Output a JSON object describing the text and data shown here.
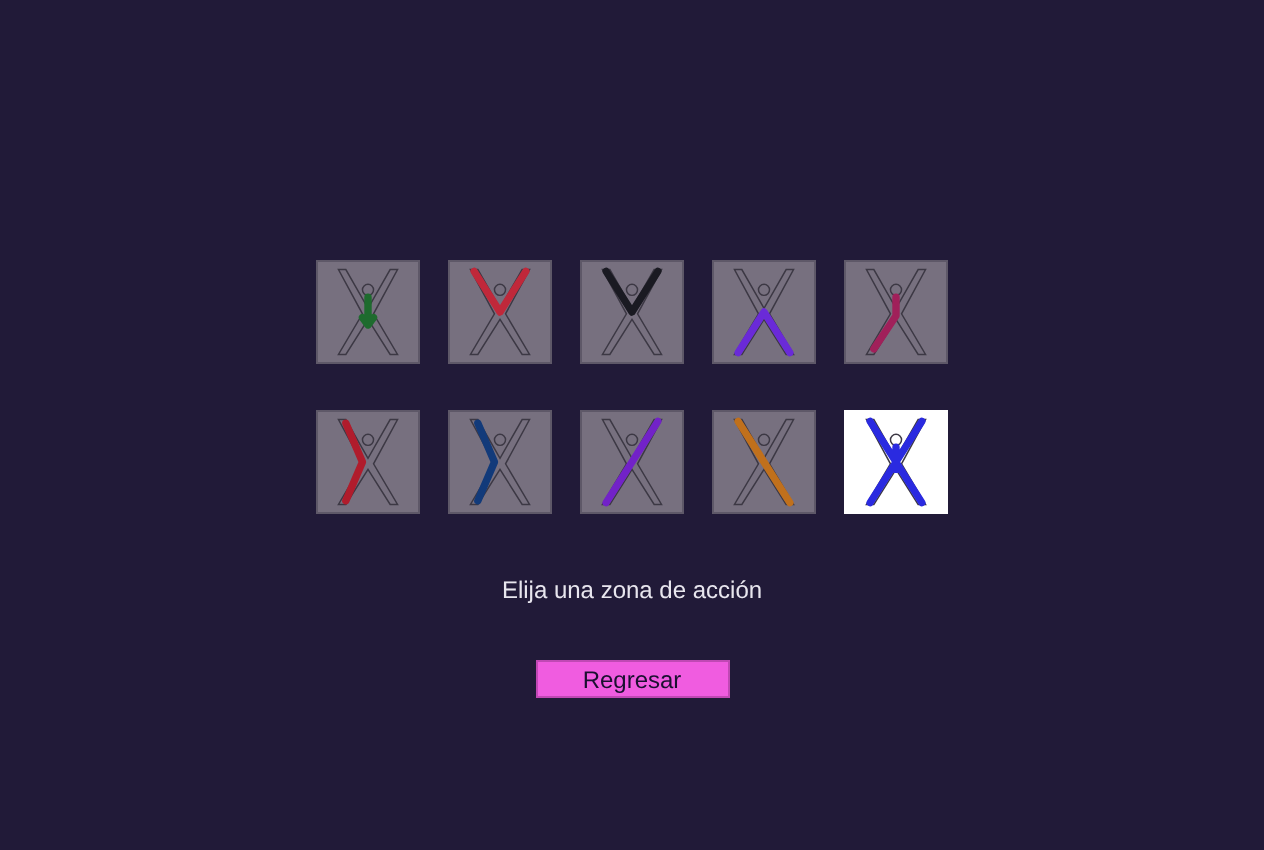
{
  "tiles": [
    {
      "kind": "torso",
      "color": "#1e6b2e",
      "selected": false
    },
    {
      "kind": "arms",
      "color": "#c0283a",
      "selected": false
    },
    {
      "kind": "arms",
      "color": "#1a1a22",
      "selected": false
    },
    {
      "kind": "legs",
      "color": "#6a2ad8",
      "selected": false
    },
    {
      "kind": "torso-leg",
      "color": "#a0205a",
      "selected": false
    },
    {
      "kind": "left-side",
      "color": "#b01c2c",
      "selected": false
    },
    {
      "kind": "left-side",
      "color": "#123a7a",
      "selected": false
    },
    {
      "kind": "diagonal",
      "color": "#7222c8",
      "selected": false
    },
    {
      "kind": "anti-diagonal",
      "color": "#c0701c",
      "selected": false
    },
    {
      "kind": "full",
      "color": "#2a2ae0",
      "selected": true
    }
  ],
  "prompt": "Elija una zona de acción",
  "button": "Regresar"
}
